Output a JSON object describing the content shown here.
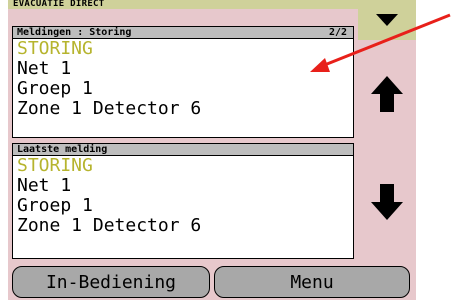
{
  "title": "EVACUATIE DIRECT",
  "messages": {
    "header": "Meldingen : Storing",
    "page": "2/2",
    "lines": [
      "STORING",
      "Net 1",
      "Groep 1",
      "Zone 1 Detector 6"
    ]
  },
  "last": {
    "header": "Laatste melding",
    "lines": [
      "STORING",
      "Net 1",
      "Groep 1",
      "Zone 1 Detector 6"
    ]
  },
  "buttons": {
    "in_bediening": "In-Bediening",
    "menu": "Menu"
  },
  "colors": {
    "screen_bg": "#e7c8cc",
    "title_bg": "#cfd19a",
    "status_text": "#b6b42e",
    "button_bg": "#a8a8a8",
    "annotation_arrow": "#e8201a"
  },
  "icons": [
    "chevron-down-icon",
    "arrow-up-icon",
    "arrow-down-icon"
  ]
}
